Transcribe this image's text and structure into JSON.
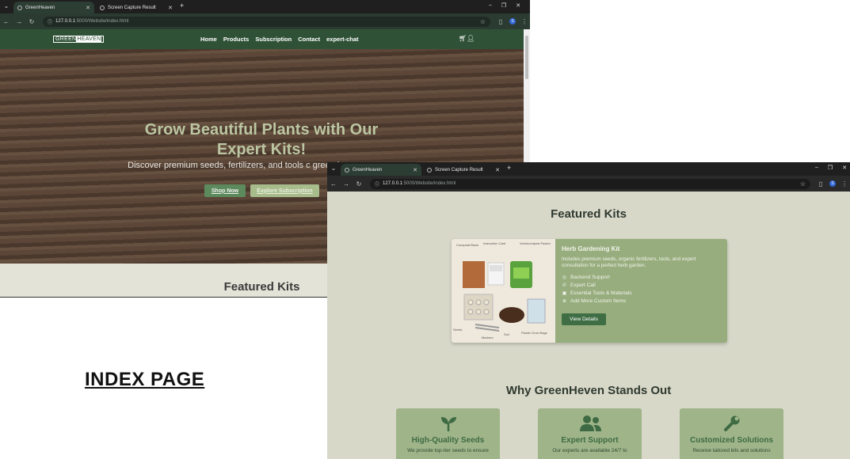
{
  "window1": {
    "tabs": [
      {
        "label": "GreenHeaven",
        "active": true
      },
      {
        "label": "Screen Capture Result",
        "active": false
      }
    ],
    "url_host": "127.0.0.1",
    "url_path": ":5000/Website/index.html",
    "site": {
      "logo_left": "GREEN",
      "logo_right": "HEAVEN",
      "nav": [
        "Home",
        "Products",
        "Subscription",
        "Contact",
        "expert-chat"
      ],
      "hero_title": "Grow Beautiful Plants with Our Expert Kits!",
      "hero_subtitle": "Discover premium seeds, fertilizers, and tools c green haven.",
      "shop_button": "Shop Now",
      "explore_button": "Explore Subscription",
      "featured_heading": "Featured Kits"
    }
  },
  "caption": "INDEX PAGE",
  "window2": {
    "tabs": [
      {
        "label": "GreenHeaven",
        "active": true
      },
      {
        "label": "Screen Capture Result",
        "active": false
      }
    ],
    "url_host": "127.0.0.1",
    "url_path": ":5000/Website/index.html",
    "featured_heading": "Featured Kits",
    "kit": {
      "title": "Herb Gardening Kit",
      "description": "Includes premium seeds, organic fertilizers, tools, and expert consultation for a perfect herb garden.",
      "features": [
        "Backend Support",
        "Expert Call",
        "Essential Tools & Materials",
        "Add More Custom Items"
      ],
      "button": "View Details",
      "image_labels": [
        "Cocopeat Block",
        "Instruction Card",
        "Vermicompost Packet",
        "Seeds",
        "Markers",
        "Soil",
        "Plastic Grow Bags"
      ]
    },
    "why_heading": "Why GreenHeven Stands Out",
    "feature_cards": [
      {
        "title": "High-Quality Seeds",
        "desc": "We provide top-tier seeds to ensure",
        "icon": "seedling-icon"
      },
      {
        "title": "Expert Support",
        "desc": "Our experts are available 24/7 to",
        "icon": "users-icon"
      },
      {
        "title": "Customized Solutions",
        "desc": "Receive tailored kits and solutions",
        "icon": "wrench-icon"
      }
    ]
  },
  "colors": {
    "nav_green": "#2f5236",
    "button_green": "#5c8a5c",
    "card_green": "#97ad7e",
    "page_bg": "#d8d8c9"
  }
}
